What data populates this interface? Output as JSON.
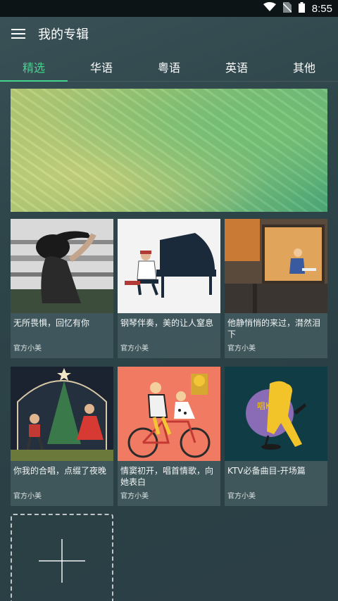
{
  "status_bar": {
    "time": "8:55",
    "icons": [
      "wifi-icon",
      "no-sim-icon",
      "battery-icon"
    ]
  },
  "app_bar": {
    "title": "我的专辑",
    "menu_icon": "hamburger-menu-icon"
  },
  "tabs": [
    {
      "label": "精选",
      "active": true
    },
    {
      "label": "华语",
      "active": false
    },
    {
      "label": "粤语",
      "active": false
    },
    {
      "label": "英语",
      "active": false
    },
    {
      "label": "其他",
      "active": false
    }
  ],
  "colors": {
    "accent": "#43d58d",
    "background": "#2d4449"
  },
  "albums": [
    {
      "title": "无所畏惧，回忆有你",
      "author": "官方小美",
      "cover": "girl-sky-illustration"
    },
    {
      "title": "钢琴伴奏，美的让人窒息",
      "author": "官方小美",
      "cover": "pianist-illustration"
    },
    {
      "title": "他静悄悄的来过，潸然泪下",
      "author": "官方小美",
      "cover": "window-reading-illustration"
    },
    {
      "title": "你我的合唱，点缀了夜晚",
      "author": "官方小美",
      "cover": "couple-duet-illustration"
    },
    {
      "title": "情窦初开，唱首情歌，向她表白",
      "author": "官方小美",
      "cover": "bicycle-couple-illustration"
    },
    {
      "title": "KTV必备曲目-开场篇",
      "author": "官方小美",
      "cover": "ktv-singer-illustration",
      "cover_text": "唱KTV"
    }
  ],
  "add_tile": {
    "icon": "plus-icon"
  }
}
